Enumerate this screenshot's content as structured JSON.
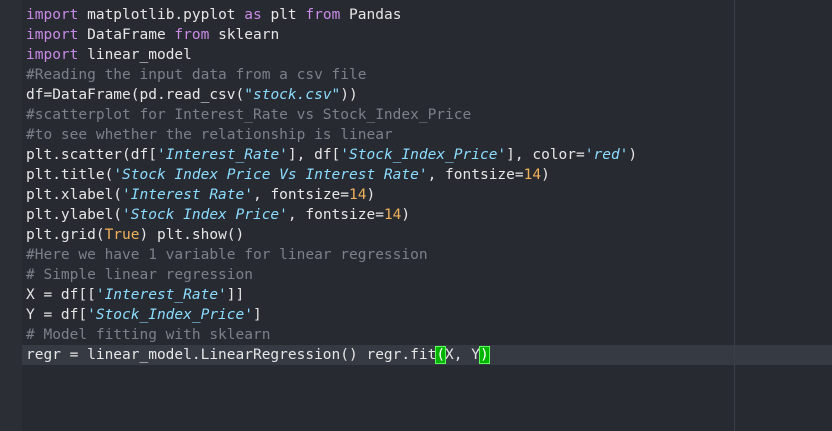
{
  "editor": {
    "colors": {
      "background": "#272a31",
      "keyword": "#c98ae6",
      "string": "#8bdcff",
      "number": "#f0b05a",
      "comment": "#7b8089",
      "text": "#e6e6e6",
      "bracket_match": "#00b400"
    },
    "lines": [
      {
        "tokens": [
          {
            "t": "import",
            "c": "keyword"
          },
          {
            "t": " matplotlib.pyplot ",
            "c": "plain"
          },
          {
            "t": "as",
            "c": "keyword"
          },
          {
            "t": " plt ",
            "c": "plain"
          },
          {
            "t": "from",
            "c": "keyword"
          },
          {
            "t": " Pandas",
            "c": "plain"
          }
        ]
      },
      {
        "tokens": [
          {
            "t": "import",
            "c": "keyword"
          },
          {
            "t": " DataFrame ",
            "c": "plain"
          },
          {
            "t": "from",
            "c": "keyword"
          },
          {
            "t": " sklearn",
            "c": "plain"
          }
        ]
      },
      {
        "tokens": [
          {
            "t": "import",
            "c": "keyword"
          },
          {
            "t": " linear_model",
            "c": "plain"
          }
        ]
      },
      {
        "tokens": [
          {
            "t": "#Reading the input data from a csv file",
            "c": "comment"
          }
        ]
      },
      {
        "tokens": [
          {
            "t": "df=DataFrame(pd.read_csv(",
            "c": "plain"
          },
          {
            "t": "\"stock.csv\"",
            "c": "string"
          },
          {
            "t": "))",
            "c": "plain"
          }
        ]
      },
      {
        "tokens": [
          {
            "t": "#scatterplot for Interest_Rate vs Stock_Index_Price",
            "c": "comment"
          }
        ]
      },
      {
        "tokens": [
          {
            "t": "#to see whether the relationship is linear",
            "c": "comment"
          }
        ]
      },
      {
        "tokens": [
          {
            "t": "plt.scatter(df[",
            "c": "plain"
          },
          {
            "t": "'Interest_Rate'",
            "c": "string"
          },
          {
            "t": "], df[",
            "c": "plain"
          },
          {
            "t": "'Stock_Index_Price'",
            "c": "string"
          },
          {
            "t": "], color=",
            "c": "plain"
          },
          {
            "t": "'red'",
            "c": "string"
          },
          {
            "t": ")",
            "c": "plain"
          }
        ]
      },
      {
        "tokens": [
          {
            "t": "plt.title(",
            "c": "plain"
          },
          {
            "t": "'Stock Index Price Vs Interest Rate'",
            "c": "string"
          },
          {
            "t": ", fontsize=",
            "c": "plain"
          },
          {
            "t": "14",
            "c": "number"
          },
          {
            "t": ")",
            "c": "plain"
          }
        ]
      },
      {
        "tokens": [
          {
            "t": "plt.xlabel(",
            "c": "plain"
          },
          {
            "t": "'Interest Rate'",
            "c": "string"
          },
          {
            "t": ", fontsize=",
            "c": "plain"
          },
          {
            "t": "14",
            "c": "number"
          },
          {
            "t": ")",
            "c": "plain"
          }
        ]
      },
      {
        "tokens": [
          {
            "t": "plt.ylabel(",
            "c": "plain"
          },
          {
            "t": "'Stock Index Price'",
            "c": "string"
          },
          {
            "t": ", fontsize=",
            "c": "plain"
          },
          {
            "t": "14",
            "c": "number"
          },
          {
            "t": ")",
            "c": "plain"
          }
        ]
      },
      {
        "tokens": [
          {
            "t": "plt.grid(",
            "c": "plain"
          },
          {
            "t": "True",
            "c": "number"
          },
          {
            "t": ") plt.show()",
            "c": "plain"
          }
        ]
      },
      {
        "tokens": [
          {
            "t": "#Here we have 1 variable for linear regression",
            "c": "comment"
          }
        ]
      },
      {
        "tokens": [
          {
            "t": "# Simple linear regression",
            "c": "comment"
          }
        ]
      },
      {
        "tokens": [
          {
            "t": "X = df[[",
            "c": "plain"
          },
          {
            "t": "'Interest_Rate'",
            "c": "string"
          },
          {
            "t": "]]",
            "c": "plain"
          }
        ]
      },
      {
        "tokens": [
          {
            "t": "Y = df[",
            "c": "plain"
          },
          {
            "t": "'Stock_Index_Price'",
            "c": "string"
          },
          {
            "t": "]",
            "c": "plain"
          }
        ]
      },
      {
        "tokens": [
          {
            "t": "# Model fitting with sklearn",
            "c": "comment"
          }
        ]
      },
      {
        "current": true,
        "tokens": [
          {
            "t": "regr = linear_model.LinearRegression() regr.fit",
            "c": "plain"
          },
          {
            "t": "(",
            "c": "bracket-match"
          },
          {
            "t": "X, Y",
            "c": "plain"
          },
          {
            "t": ")",
            "c": "bracket-match"
          }
        ]
      }
    ]
  }
}
